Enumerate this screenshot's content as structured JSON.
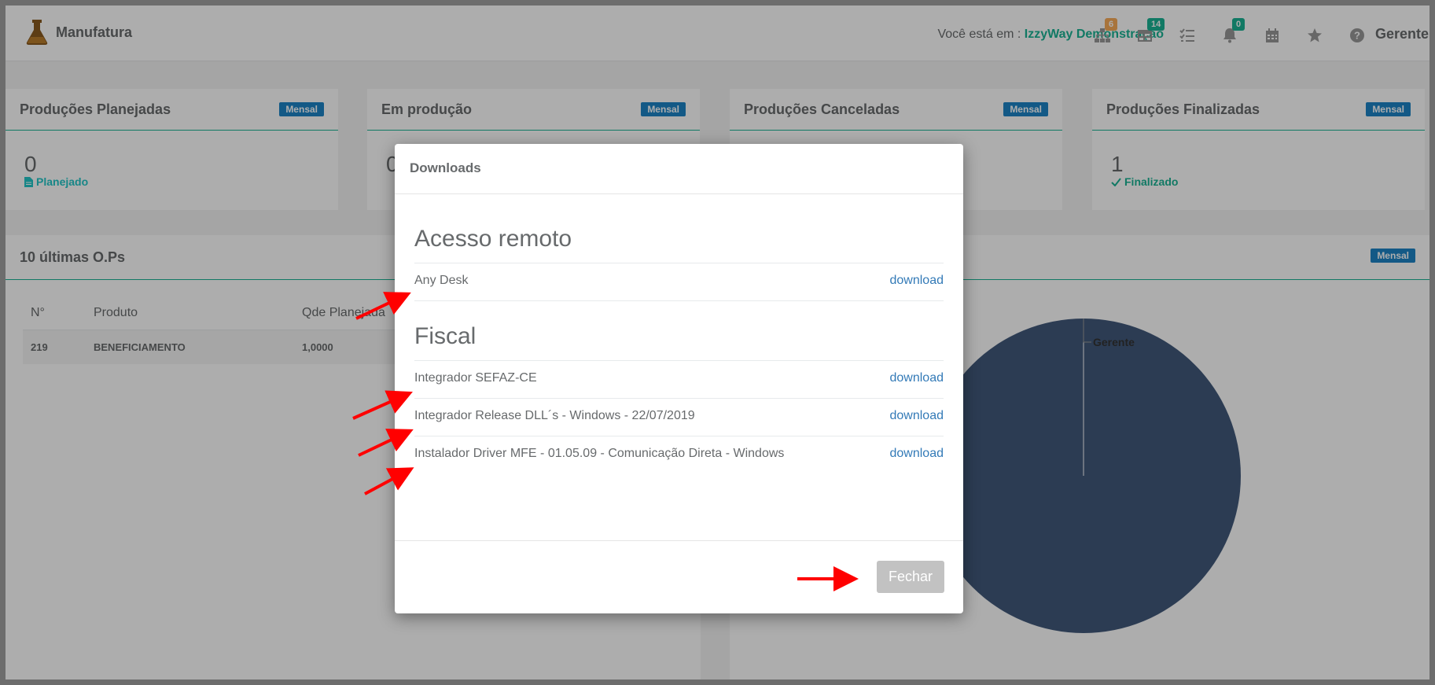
{
  "header": {
    "app_title": "Manufatura",
    "context_prefix": "Você está em : ",
    "company_name": "IzzyWay Demonstração",
    "nav_badges": {
      "org": "6",
      "table": "14",
      "notifications": "0"
    },
    "user_name": "Gerente"
  },
  "cards": [
    {
      "title": "Produções Planejadas",
      "badge": "Mensal",
      "value": "0",
      "status": "Planejado"
    },
    {
      "title": "Em produção",
      "badge": "Mensal",
      "value": "0",
      "status": ""
    },
    {
      "title": "Produções Canceladas",
      "badge": "Mensal",
      "value": "",
      "status": ""
    },
    {
      "title": "Produções Finalizadas",
      "badge": "Mensal",
      "value": "1",
      "status": "Finalizado"
    }
  ],
  "ops_panel": {
    "title": "10 últimas O.Ps",
    "columns": [
      "N°",
      "Produto",
      "Qde Planejada"
    ],
    "rows": [
      {
        "n": "219",
        "produto": "BENEFICIAMENTO",
        "qde": "1,0000"
      }
    ]
  },
  "chart_panel": {
    "badge": "Mensal",
    "chart_data": {
      "type": "pie",
      "categories": [
        "Gerente"
      ],
      "values": [
        1
      ],
      "colors": [
        "#41597b"
      ]
    }
  },
  "modal": {
    "title": "Downloads",
    "sections": [
      {
        "heading": "Acesso remoto",
        "items": [
          {
            "name": "Any Desk",
            "link": "download"
          }
        ]
      },
      {
        "heading": "Fiscal",
        "items": [
          {
            "name": "Integrador SEFAZ-CE",
            "link": "download"
          },
          {
            "name": "Integrador Release DLL´s - Windows - 22/07/2019",
            "link": "download"
          },
          {
            "name": "Instalador Driver MFE - 01.05.09 - Comunicação Direta - Windows",
            "link": "download"
          }
        ]
      }
    ],
    "close_label": "Fechar"
  },
  "annotation_color": "#ff0000"
}
